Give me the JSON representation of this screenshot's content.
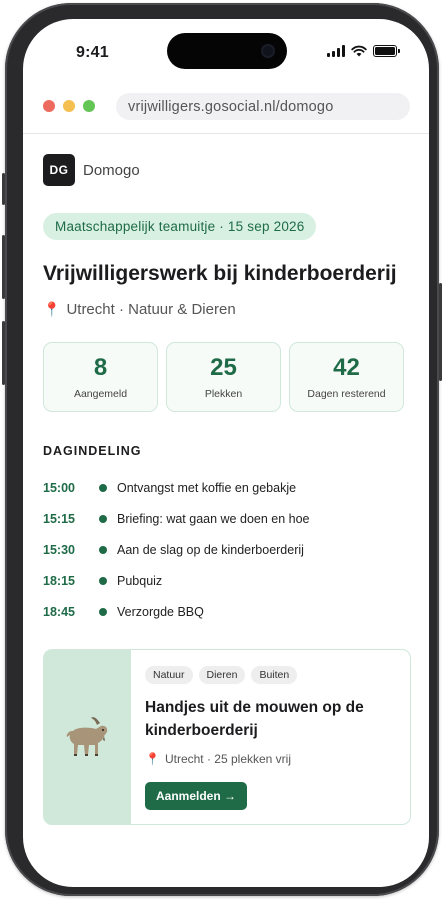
{
  "status_bar": {
    "time": "9:41"
  },
  "browser": {
    "url": "vrijwilligers.gosocial.nl/domogo",
    "traffic_lights": {
      "close": "#ed6a5e",
      "minimize": "#f5bf4f",
      "maximize": "#62c554"
    }
  },
  "brand": {
    "logo_text": "DG",
    "name": "Domogo"
  },
  "event": {
    "pill": "Maatschappelijk teamuitje · 15 sep 2026",
    "title": "Vrijwilligerswerk bij kinderboerderij",
    "location": "Utrecht · Natuur & Dieren",
    "location_icon": "map-pin-icon"
  },
  "stats": [
    {
      "value": "8",
      "label": "Aangemeld"
    },
    {
      "value": "25",
      "label": "Plekken"
    },
    {
      "value": "42",
      "label": "Dagen resterend"
    }
  ],
  "schedule": {
    "title": "DAGINDELING",
    "items": [
      {
        "time": "15:00",
        "text": "Ontvangst met koffie en gebakje"
      },
      {
        "time": "15:15",
        "text": "Briefing: wat gaan we doen en hoe"
      },
      {
        "time": "15:30",
        "text": "Aan de slag op de kinderboerderij"
      },
      {
        "time": "18:15",
        "text": "Pubquiz"
      },
      {
        "time": "18:45",
        "text": "Verzorgde BBQ"
      }
    ]
  },
  "card": {
    "image_icon": "goat-icon",
    "tags": [
      "Natuur",
      "Dieren",
      "Buiten"
    ],
    "title": "Handjes uit de mouwen op de kinderboerderij",
    "meta": "Utrecht · 25 plekken vrij",
    "button": "Aanmelden →"
  },
  "colors": {
    "accent": "#1f6b47",
    "accent_light": "#d7f0e2"
  }
}
